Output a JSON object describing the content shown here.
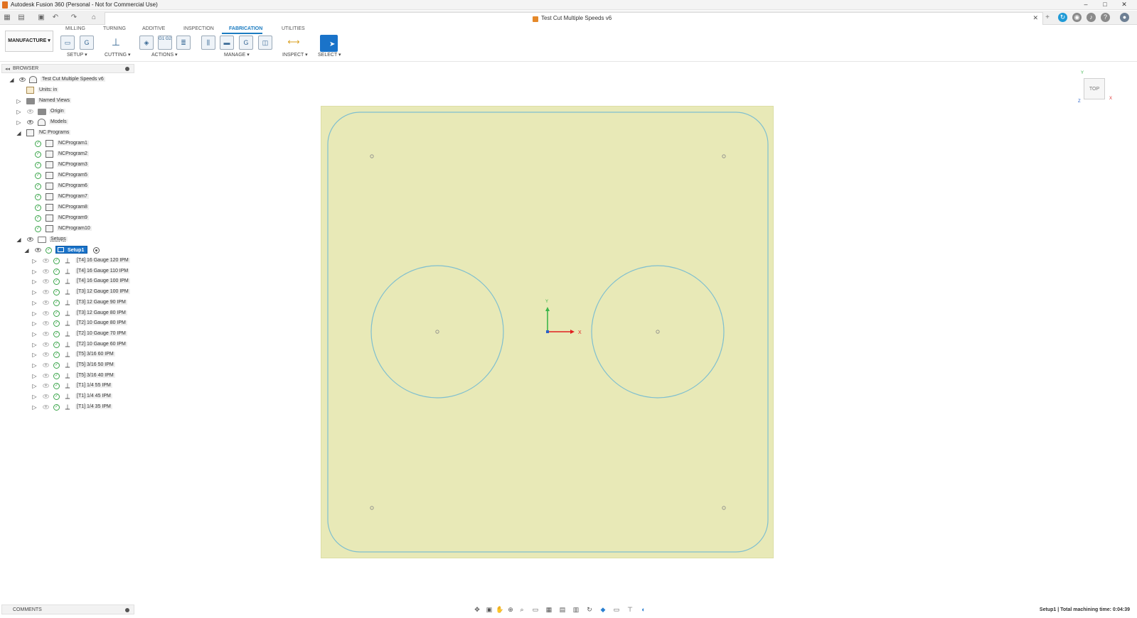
{
  "window": {
    "title": "Autodesk Fusion 360 (Personal - Not for Commercial Use)",
    "controls": {
      "minimize": "–",
      "maximize": "□",
      "close": "✕"
    }
  },
  "document": {
    "title": "Test Cut Multiple Speeds v6",
    "close": "✕"
  },
  "ribbon": {
    "workspace": "MANUFACTURE ▾",
    "tabs": [
      "MILLING",
      "TURNING",
      "ADDITIVE",
      "INSPECTION",
      "FABRICATION",
      "UTILITIES"
    ],
    "active_tab": "FABRICATION",
    "groups": {
      "setup": "SETUP ▾",
      "cutting": "CUTTING ▾",
      "actions": "ACTIONS ▾",
      "manage": "MANAGE ▾",
      "inspect": "INSPECT ▾",
      "select": "SELECT ▾"
    },
    "icon_labels": {
      "gcode": "G1\nG2",
      "g": "G"
    }
  },
  "browser": {
    "title": "BROWSER",
    "collapse": "◂◂",
    "root": "Test Cut Multiple Speeds v6",
    "units": "Units: in",
    "named_views": "Named Views",
    "origin": "Origin",
    "models": "Models",
    "nc_programs": "NC Programs",
    "nc_list": [
      "NCProgram1",
      "NCProgram2",
      "NCProgram3",
      "NCProgram5",
      "NCProgram6",
      "NCProgram7",
      "NCProgram8",
      "NCProgram9",
      "NCProgram10"
    ],
    "setups": "Setups",
    "setup1": "Setup1",
    "operations": [
      "[T4] 16 Gauge 120 IPM",
      "[T4] 16 Gauge 110 IPM",
      "[T4] 16 Gauge 100 IPM",
      "[T3] 12 Gauge 100 IPM",
      "[T3] 12 Gauge 90 IPM",
      "[T3] 12 Gauge 80 IPM",
      "[T2] 10 Gauge 80 IPM",
      "[T2] 10 Gauge 70 IPM",
      "[T2] 10 Gauge 60 IPM",
      "[T5] 3/16 60 IPM",
      "[T5] 3/16 50 IPM",
      "[T5] 3/16 40 IPM",
      "[T1] 1/4 55 IPM",
      "[T1] 1/4 45 IPM",
      "[T1] 1/4 35 IPM"
    ]
  },
  "viewcube": {
    "face": "TOP",
    "x": "X",
    "y": "Y",
    "z": "Z"
  },
  "origin_axes": {
    "x": "X",
    "y": "Y"
  },
  "comments": {
    "title": "COMMENTS"
  },
  "status": {
    "text": "Setup1 | Total machining time: 0:04:39"
  },
  "colors": {
    "accent": "#1c7cc1",
    "select_active": "#1a73c9",
    "stock": "#e8e9b7",
    "sketch_line": "#7fbfcf",
    "axis_x": "#e02020",
    "axis_y": "#3bb54a"
  }
}
